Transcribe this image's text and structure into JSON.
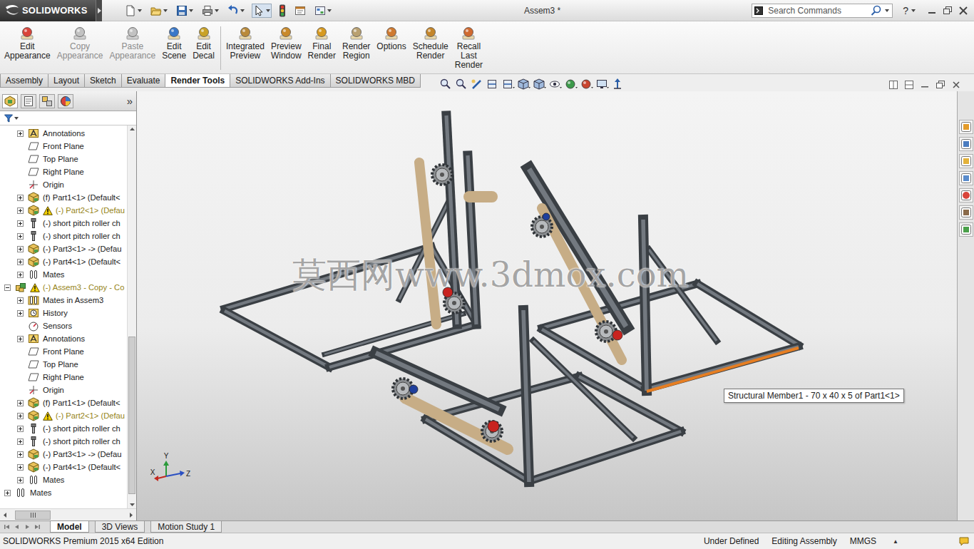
{
  "window": {
    "app": "SOLIDWORKS",
    "title": "Assem3 *"
  },
  "search": {
    "placeholder": "Search Commands"
  },
  "help": "?",
  "ribbon": [
    [
      {
        "lines": [
          "Edit",
          "Appearance"
        ],
        "disabled": false
      },
      {
        "lines": [
          "Copy",
          "Appearance"
        ],
        "disabled": true
      },
      {
        "lines": [
          "Paste",
          "Appearance"
        ],
        "disabled": true
      },
      {
        "lines": [
          "Edit",
          "Scene"
        ],
        "disabled": false
      },
      {
        "lines": [
          "Edit",
          "Decal"
        ],
        "disabled": false
      }
    ],
    [
      {
        "lines": [
          "Integrated",
          "Preview"
        ],
        "disabled": false
      },
      {
        "lines": [
          "Preview",
          "Window"
        ],
        "disabled": false
      },
      {
        "lines": [
          "Final",
          "Render"
        ],
        "disabled": false
      },
      {
        "lines": [
          "Render",
          "Region"
        ],
        "disabled": false
      },
      {
        "lines": [
          "Options"
        ],
        "disabled": false
      },
      {
        "lines": [
          "Schedule",
          "Render"
        ],
        "disabled": false
      },
      {
        "lines": [
          "Recall",
          "Last",
          "Render"
        ],
        "disabled": false
      }
    ]
  ],
  "tabs": [
    {
      "label": "Assembly",
      "selected": false
    },
    {
      "label": "Layout",
      "selected": false
    },
    {
      "label": "Sketch",
      "selected": false
    },
    {
      "label": "Evaluate",
      "selected": false
    },
    {
      "label": "Render Tools",
      "selected": true
    },
    {
      "label": "SOLIDWORKS Add-Ins",
      "selected": false
    },
    {
      "label": "SOLIDWORKS MBD",
      "selected": false
    }
  ],
  "panel": {
    "more": "»"
  },
  "tree": [
    {
      "label": "Annotations",
      "kind": "annotations",
      "depth": 1,
      "expandable": true,
      "expanded": false,
      "warning": false
    },
    {
      "label": "Front Plane",
      "kind": "plane",
      "depth": 1,
      "expandable": false,
      "expanded": false,
      "warning": false
    },
    {
      "label": "Top Plane",
      "kind": "plane",
      "depth": 1,
      "expandable": false,
      "expanded": false,
      "warning": false
    },
    {
      "label": "Right Plane",
      "kind": "plane",
      "depth": 1,
      "expandable": false,
      "expanded": false,
      "warning": false
    },
    {
      "label": "Origin",
      "kind": "origin",
      "depth": 1,
      "expandable": false,
      "expanded": false,
      "warning": false
    },
    {
      "label": "(f) Part1<1> (Default<",
      "kind": "part",
      "depth": 1,
      "expandable": true,
      "expanded": false,
      "warning": false
    },
    {
      "label": "(-) Part2<1> (Defau",
      "kind": "part",
      "depth": 1,
      "expandable": true,
      "expanded": false,
      "warning": true
    },
    {
      "label": "(-) short pitch roller ch",
      "kind": "toolbox",
      "depth": 1,
      "expandable": true,
      "expanded": false,
      "warning": false
    },
    {
      "label": "(-) short pitch roller ch",
      "kind": "toolbox",
      "depth": 1,
      "expandable": true,
      "expanded": false,
      "warning": false
    },
    {
      "label": "(-) Part3<1> -> (Defau",
      "kind": "part",
      "depth": 1,
      "expandable": true,
      "expanded": false,
      "warning": false
    },
    {
      "label": "(-) Part4<1> (Default<",
      "kind": "part",
      "depth": 1,
      "expandable": true,
      "expanded": false,
      "warning": false
    },
    {
      "label": "Mates",
      "kind": "mates",
      "depth": 1,
      "expandable": true,
      "expanded": false,
      "warning": false
    },
    {
      "label": "(-) Assem3 - Copy - Co",
      "kind": "assembly",
      "depth": 0,
      "expandable": true,
      "expanded": true,
      "warning": true
    },
    {
      "label": "Mates in Assem3",
      "kind": "mates-folder",
      "depth": 1,
      "expandable": true,
      "expanded": false,
      "warning": false
    },
    {
      "label": "History",
      "kind": "history",
      "depth": 1,
      "expandable": true,
      "expanded": false,
      "warning": false
    },
    {
      "label": "Sensors",
      "kind": "sensors",
      "depth": 1,
      "expandable": false,
      "expanded": false,
      "warning": false
    },
    {
      "label": "Annotations",
      "kind": "annotations",
      "depth": 1,
      "expandable": true,
      "expanded": false,
      "warning": false
    },
    {
      "label": "Front Plane",
      "kind": "plane",
      "depth": 1,
      "expandable": false,
      "expanded": false,
      "warning": false
    },
    {
      "label": "Top Plane",
      "kind": "plane",
      "depth": 1,
      "expandable": false,
      "expanded": false,
      "warning": false
    },
    {
      "label": "Right Plane",
      "kind": "plane",
      "depth": 1,
      "expandable": false,
      "expanded": false,
      "warning": false
    },
    {
      "label": "Origin",
      "kind": "origin",
      "depth": 1,
      "expandable": false,
      "expanded": false,
      "warning": false
    },
    {
      "label": "(f) Part1<1> (Default<",
      "kind": "part",
      "depth": 1,
      "expandable": true,
      "expanded": false,
      "warning": false
    },
    {
      "label": "(-) Part2<1> (Defau",
      "kind": "part",
      "depth": 1,
      "expandable": true,
      "expanded": false,
      "warning": true
    },
    {
      "label": "(-) short pitch roller ch",
      "kind": "toolbox",
      "depth": 1,
      "expandable": true,
      "expanded": false,
      "warning": false
    },
    {
      "label": "(-) short pitch roller ch",
      "kind": "toolbox",
      "depth": 1,
      "expandable": true,
      "expanded": false,
      "warning": false
    },
    {
      "label": "(-) Part3<1> -> (Defau",
      "kind": "part",
      "depth": 1,
      "expandable": true,
      "expanded": false,
      "warning": false
    },
    {
      "label": "(-) Part4<1> (Default<",
      "kind": "part",
      "depth": 1,
      "expandable": true,
      "expanded": false,
      "warning": false
    },
    {
      "label": "Mates",
      "kind": "mates",
      "depth": 1,
      "expandable": true,
      "expanded": false,
      "warning": false
    },
    {
      "label": "Mates",
      "kind": "mates",
      "depth": 0,
      "expandable": true,
      "expanded": false,
      "warning": false
    }
  ],
  "viewport": {
    "watermark": "莫西网www.3dmox.com",
    "tooltip": "Structural Member1 - 70 x 40 x 5 of Part1<1>",
    "axes": [
      "Y",
      "X",
      "Z"
    ]
  },
  "bottom_tabs": [
    {
      "label": "Model",
      "selected": true
    },
    {
      "label": "3D Views",
      "selected": false
    },
    {
      "label": "Motion Study 1",
      "selected": false
    }
  ],
  "status_bar": {
    "product": "SOLIDWORKS Premium 2015 x64 Edition",
    "items": [
      "Under Defined",
      "Editing Assembly",
      "MMGS"
    ],
    "unit_arrow": "▲"
  }
}
